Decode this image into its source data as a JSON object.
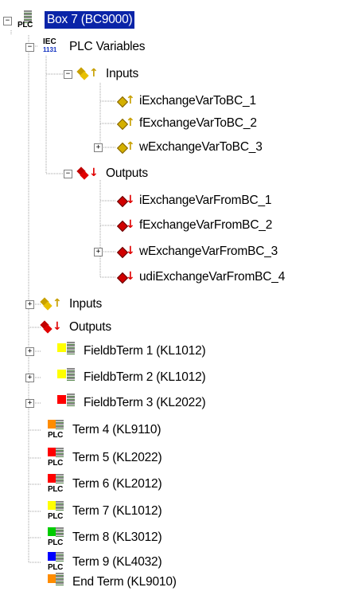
{
  "tree": {
    "root": {
      "label": "Box 7 (BC9000)",
      "selected": true
    },
    "plc_variables": {
      "label": "PLC Variables",
      "icon_text_top": "IEC",
      "icon_text_bottom": "1131"
    },
    "inputs_group": {
      "label": "Inputs"
    },
    "inputs_vars": [
      {
        "label": "iExchangeVarToBC_1"
      },
      {
        "label": "fExchangeVarToBC_2"
      },
      {
        "label": "wExchangeVarToBC_3"
      }
    ],
    "outputs_group": {
      "label": "Outputs"
    },
    "outputs_vars": [
      {
        "label": "iExchangeVarFromBC_1"
      },
      {
        "label": "fExchangeVarFromBC_2"
      },
      {
        "label": "wExchangeVarFromBC_3"
      },
      {
        "label": "udiExchangeVarFromBC_4"
      }
    ],
    "box_inputs": {
      "label": "Inputs"
    },
    "box_outputs": {
      "label": "Outputs"
    },
    "terminals": [
      {
        "label": "FieldbTerm 1 (KL1012)",
        "color": "#ffff00"
      },
      {
        "label": "FieldbTerm 2 (KL1012)",
        "color": "#ffff00"
      },
      {
        "label": "FieldbTerm 3 (KL2022)",
        "color": "#ff0000"
      },
      {
        "label": "Term 4 (KL9110)",
        "color": "#ff8c00"
      },
      {
        "label": "Term 5 (KL2022)",
        "color": "#ff0000"
      },
      {
        "label": "Term 6 (KL2012)",
        "color": "#ff0000"
      },
      {
        "label": "Term 7 (KL1012)",
        "color": "#ffff00"
      },
      {
        "label": "Term 8 (KL3012)",
        "color": "#00cc00"
      },
      {
        "label": "Term 9 (KL4032)",
        "color": "#0000ff"
      },
      {
        "label": "End Term (KL9010)",
        "color": "#ff8c00"
      }
    ],
    "plc_tag": "PLC",
    "colors": {
      "selection": "#0a24a8",
      "input_arrow": "#c8a000",
      "output_arrow": "#e00000"
    }
  }
}
